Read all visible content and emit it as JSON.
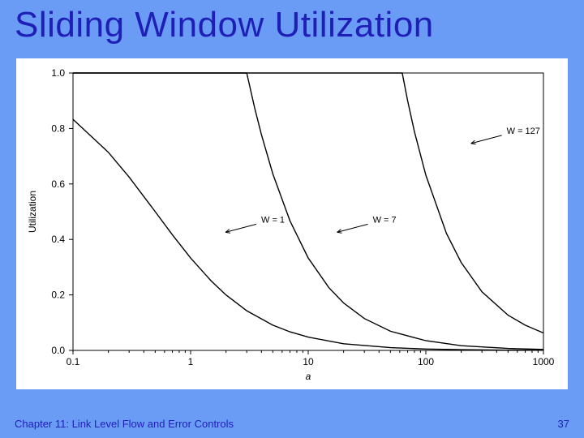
{
  "slide": {
    "title": "Sliding Window Utilization",
    "footer": "Chapter 11: Link Level Flow and Error Controls",
    "page_number": "37"
  },
  "chart_data": {
    "type": "line",
    "title": "",
    "xlabel": "a",
    "ylabel": "Utilization",
    "x_scale": "log",
    "xlim": [
      0.1,
      1000
    ],
    "ylim": [
      0.0,
      1.0
    ],
    "x_ticks": [
      0.1,
      1,
      10,
      100,
      1000
    ],
    "y_ticks": [
      0.0,
      0.2,
      0.4,
      0.6,
      0.8,
      1.0
    ],
    "series": [
      {
        "name": "W = 1",
        "W": 1,
        "x": [
          0.1,
          0.2,
          0.3,
          0.5,
          0.7,
          1,
          1.5,
          2,
          3,
          5,
          7,
          10,
          20,
          50,
          100,
          200,
          500,
          1000
        ],
        "y": [
          0.833,
          0.714,
          0.625,
          0.5,
          0.417,
          0.333,
          0.25,
          0.2,
          0.143,
          0.091,
          0.067,
          0.048,
          0.024,
          0.01,
          0.005,
          0.0025,
          0.001,
          0.0005
        ]
      },
      {
        "name": "W = 7",
        "W": 7,
        "x": [
          0.1,
          1,
          2,
          3,
          3.5,
          4,
          5,
          7,
          10,
          15,
          20,
          30,
          50,
          100,
          200,
          500,
          1000
        ],
        "y": [
          1.0,
          1.0,
          1.0,
          1.0,
          0.875,
          0.778,
          0.636,
          0.467,
          0.333,
          0.226,
          0.171,
          0.115,
          0.069,
          0.035,
          0.017,
          0.007,
          0.0035
        ]
      },
      {
        "name": "W = 127",
        "W": 127,
        "x": [
          0.1,
          1,
          10,
          50,
          63,
          70,
          80,
          100,
          150,
          200,
          300,
          500,
          700,
          1000
        ],
        "y": [
          1.0,
          1.0,
          1.0,
          1.0,
          1.0,
          0.901,
          0.789,
          0.632,
          0.421,
          0.317,
          0.211,
          0.127,
          0.091,
          0.063
        ]
      }
    ],
    "annotations": [
      {
        "label": "W = 1",
        "at_x": 1.8,
        "at_y": 0.42
      },
      {
        "label": "W = 7",
        "at_x": 16,
        "at_y": 0.42
      },
      {
        "label": "W = 127",
        "at_x": 220,
        "at_y": 0.74
      }
    ]
  }
}
